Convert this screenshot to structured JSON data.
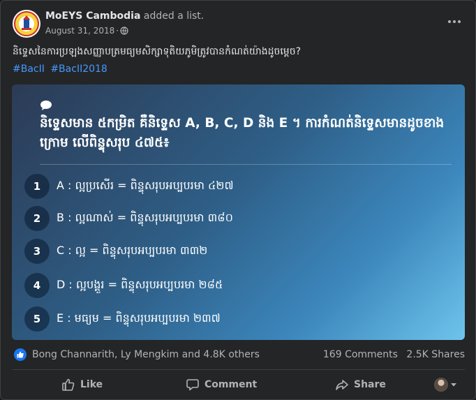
{
  "post": {
    "author": "MoEYS Cambodia",
    "action": "added a list.",
    "date": "August 31, 2018",
    "separator": "·",
    "text": "និទ្ទេសនៃការប្រឡងសញ្ញាបត្រមធ្យមសិក្សាទុតិយភូមិត្រូវបានកំណត់យ៉ាងដូចម្តេច?",
    "hashtags": [
      "#BacII",
      "#BacII2018"
    ]
  },
  "quiz": {
    "title": "និទ្ទេសមាន ៥កម្រិត គឺនិទ្ទេស A, B, C, D និង E ។ ការកំណត់និទ្ទេសមានដូចខាងក្រោម លើពិន្ទុសរុប ៤៧៥៖",
    "options": [
      {
        "num": "1",
        "text": "A : ល្អប្រសើរ = ពិន្ទុសរុបអប្បបរមា ៤២៧"
      },
      {
        "num": "2",
        "text": "B : ល្អណាស់ = ពិន្ទុសរុបអប្បបរមា ៣៨០"
      },
      {
        "num": "3",
        "text": "C : ល្អ = ពិន្ទុសរុបអប្បបរមា ៣៣២"
      },
      {
        "num": "4",
        "text": "D : ល្អបង្គួរ = ពិន្ទុសរុបអប្បបរមា ២៨៥"
      },
      {
        "num": "5",
        "text": "E : មធ្យម = ពិន្ទុសរុបអប្បបរមា ២៣៧"
      }
    ]
  },
  "stats": {
    "reactors": "Bong Channarith, Ly Mengkim and 4.8K others",
    "comments": "169 Comments",
    "shares": "2.5K Shares"
  },
  "actions": {
    "like": "Like",
    "comment": "Comment",
    "share": "Share"
  },
  "colors": {
    "background": "#242526",
    "text_primary": "#e4e6eb",
    "text_secondary": "#b0b3b8",
    "hashtag": "#4599ff",
    "like_badge": "#1877f2",
    "quiz_gradient_start": "#2c3b55",
    "quiz_gradient_end": "#6ec4ec"
  },
  "icons": {
    "avatar": "moeys-logo-icon",
    "audience": "globe-icon",
    "more": "more-options-icon",
    "quiz_bubble": "speech-bubble-icon",
    "like_badge": "thumbs-up-icon",
    "like_action": "like-icon",
    "comment_action": "comment-icon",
    "share_action": "share-icon",
    "account_switch": "chevron-down-icon"
  }
}
